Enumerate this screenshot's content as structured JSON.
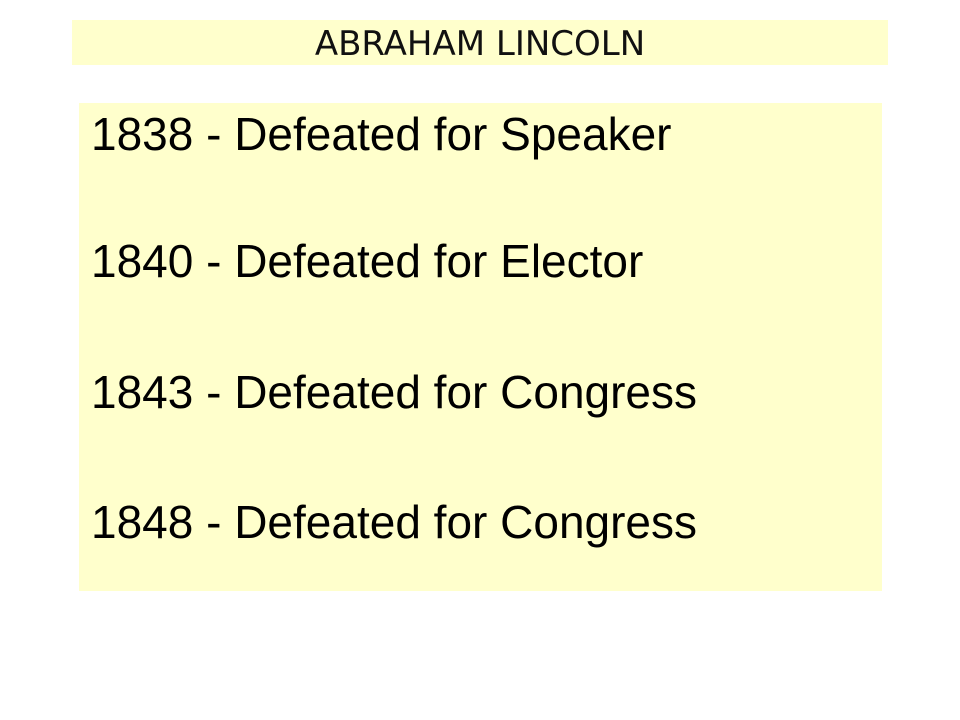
{
  "slide": {
    "title": "ABRAHAM LINCOLN",
    "items": [
      "1838 - Defeated for Speaker",
      "1840 - Defeated for Elector",
      "1843 - Defeated for Congress",
      "1848 - Defeated for Congress"
    ]
  }
}
